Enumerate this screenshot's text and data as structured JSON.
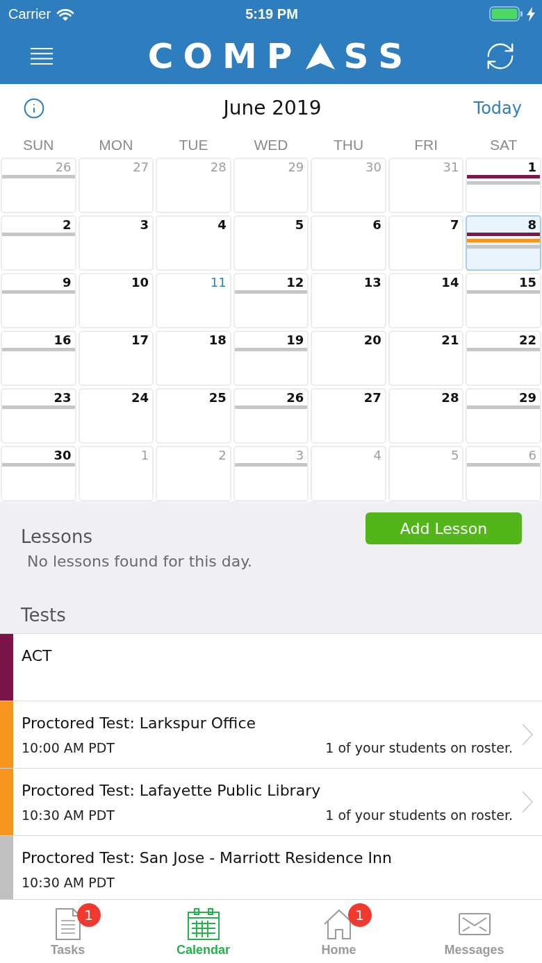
{
  "status_bar": {
    "carrier": "Carrier",
    "time": "5:19 PM"
  },
  "nav_bar": {
    "logo_start": "COMP",
    "logo_end": "SS"
  },
  "calendar": {
    "month": "June 2019",
    "today_button": "Today",
    "weekdays": [
      "SUN",
      "MON",
      "TUE",
      "WED",
      "THU",
      "FRI",
      "SAT"
    ],
    "weeks": [
      {
        "days": [
          {
            "day": "26",
            "in_month": false,
            "today": false,
            "selected": false,
            "events": [
              {
                "color": "#c6c6c6"
              }
            ]
          },
          {
            "day": "27",
            "in_month": false,
            "today": false,
            "selected": false
          },
          {
            "day": "28",
            "in_month": false,
            "today": false,
            "selected": false
          },
          {
            "day": "29",
            "in_month": false,
            "today": false,
            "selected": false
          },
          {
            "day": "30",
            "in_month": false,
            "today": false,
            "selected": false
          },
          {
            "day": "31",
            "in_month": false,
            "today": false,
            "selected": false
          },
          {
            "day": "1",
            "in_month": true,
            "today": false,
            "selected": false,
            "events": [
              {
                "color": "#7d1749"
              },
              {
                "color": "#c6c6c6"
              }
            ]
          }
        ]
      },
      {
        "days": [
          {
            "day": "2",
            "in_month": true,
            "today": false,
            "selected": false,
            "events": [
              {
                "color": "#c6c6c6"
              }
            ]
          },
          {
            "day": "3",
            "in_month": true,
            "today": false,
            "selected": false
          },
          {
            "day": "4",
            "in_month": true,
            "today": false,
            "selected": false
          },
          {
            "day": "5",
            "in_month": true,
            "today": false,
            "selected": false
          },
          {
            "day": "6",
            "in_month": true,
            "today": false,
            "selected": false
          },
          {
            "day": "7",
            "in_month": true,
            "today": false,
            "selected": false
          },
          {
            "day": "8",
            "in_month": true,
            "today": false,
            "selected": true,
            "events": [
              {
                "color": "#7d1749"
              },
              {
                "color": "#f7941d"
              },
              {
                "color": "#c6c6c6"
              }
            ]
          }
        ]
      },
      {
        "days": [
          {
            "day": "9",
            "in_month": true,
            "today": false,
            "selected": false,
            "events": [
              {
                "color": "#c6c6c6"
              }
            ]
          },
          {
            "day": "10",
            "in_month": true,
            "today": false,
            "selected": false
          },
          {
            "day": "11",
            "in_month": true,
            "today": true,
            "selected": false
          },
          {
            "day": "12",
            "in_month": true,
            "today": false,
            "selected": false,
            "events": [
              {
                "color": "#c6c6c6"
              }
            ]
          },
          {
            "day": "13",
            "in_month": true,
            "today": false,
            "selected": false
          },
          {
            "day": "14",
            "in_month": true,
            "today": false,
            "selected": false
          },
          {
            "day": "15",
            "in_month": true,
            "today": false,
            "selected": false,
            "events": [
              {
                "color": "#c6c6c6"
              }
            ]
          }
        ]
      },
      {
        "days": [
          {
            "day": "16",
            "in_month": true,
            "today": false,
            "selected": false,
            "events": [
              {
                "color": "#c6c6c6"
              }
            ]
          },
          {
            "day": "17",
            "in_month": true,
            "today": false,
            "selected": false
          },
          {
            "day": "18",
            "in_month": true,
            "today": false,
            "selected": false
          },
          {
            "day": "19",
            "in_month": true,
            "today": false,
            "selected": false,
            "events": [
              {
                "color": "#c6c6c6"
              }
            ]
          },
          {
            "day": "20",
            "in_month": true,
            "today": false,
            "selected": false
          },
          {
            "day": "21",
            "in_month": true,
            "today": false,
            "selected": false
          },
          {
            "day": "22",
            "in_month": true,
            "today": false,
            "selected": false,
            "events": [
              {
                "color": "#c6c6c6"
              }
            ]
          }
        ]
      },
      {
        "days": [
          {
            "day": "23",
            "in_month": true,
            "today": false,
            "selected": false,
            "events": [
              {
                "color": "#c6c6c6"
              }
            ]
          },
          {
            "day": "24",
            "in_month": true,
            "today": false,
            "selected": false
          },
          {
            "day": "25",
            "in_month": true,
            "today": false,
            "selected": false
          },
          {
            "day": "26",
            "in_month": true,
            "today": false,
            "selected": false,
            "events": [
              {
                "color": "#c6c6c6"
              }
            ]
          },
          {
            "day": "27",
            "in_month": true,
            "today": false,
            "selected": false
          },
          {
            "day": "28",
            "in_month": true,
            "today": false,
            "selected": false
          },
          {
            "day": "29",
            "in_month": true,
            "today": false,
            "selected": false,
            "events": [
              {
                "color": "#c6c6c6"
              }
            ]
          }
        ]
      },
      {
        "days": [
          {
            "day": "30",
            "in_month": true,
            "today": false,
            "selected": false,
            "events": [
              {
                "color": "#c6c6c6"
              }
            ]
          },
          {
            "day": "1",
            "in_month": false,
            "today": false,
            "selected": false
          },
          {
            "day": "2",
            "in_month": false,
            "today": false,
            "selected": false
          },
          {
            "day": "3",
            "in_month": false,
            "today": false,
            "selected": false,
            "events": [
              {
                "color": "#c6c6c6"
              }
            ]
          },
          {
            "day": "4",
            "in_month": false,
            "today": false,
            "selected": false
          },
          {
            "day": "5",
            "in_month": false,
            "today": false,
            "selected": false
          },
          {
            "day": "6",
            "in_month": false,
            "today": false,
            "selected": false,
            "events": [
              {
                "color": "#c6c6c6"
              }
            ]
          }
        ]
      }
    ]
  },
  "lessons": {
    "title": "Lessons",
    "empty_text": "No lessons found for this day.",
    "add_button": "Add Lesson"
  },
  "tests": {
    "title": "Tests",
    "items": [
      {
        "title": "ACT",
        "color": "#7b1448",
        "disclosure": false
      },
      {
        "title": "Proctored Test: Larkspur Office",
        "time": "10:00 AM PDT",
        "roster": "1 of your students on roster.",
        "color": "#f7941d",
        "disclosure": true
      },
      {
        "title": "Proctored Test: Lafayette Public Library",
        "time": "10:30 AM PDT",
        "roster": "1 of your students on roster.",
        "color": "#f7941d",
        "disclosure": true
      },
      {
        "title": "Proctored Test: San Jose - Marriott Residence Inn",
        "time": "10:30 AM PDT",
        "color": "#c0c0c0",
        "disclosure": false
      }
    ]
  },
  "tab_bar": {
    "tabs": [
      {
        "label": "Tasks",
        "kind": "tasks",
        "selected": false,
        "badge": "1"
      },
      {
        "label": "Calendar",
        "kind": "calendar",
        "selected": true
      },
      {
        "label": "Home",
        "kind": "home",
        "selected": false,
        "badge": "1"
      },
      {
        "label": "Messages",
        "kind": "messages",
        "selected": false
      }
    ]
  }
}
